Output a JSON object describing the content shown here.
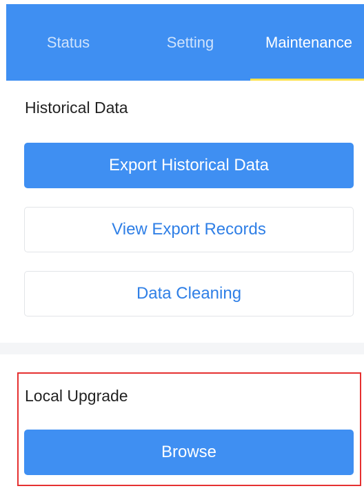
{
  "tabs": [
    {
      "label": "Status",
      "active": false
    },
    {
      "label": "Setting",
      "active": false
    },
    {
      "label": "Maintenance",
      "active": true
    }
  ],
  "historical": {
    "title": "Historical Data",
    "export_label": "Export Historical Data",
    "records_label": "View Export Records",
    "cleaning_label": "Data Cleaning"
  },
  "upgrade": {
    "title": "Local Upgrade",
    "browse_label": "Browse"
  },
  "colors": {
    "primary": "#3f8ff2",
    "active_tab_indicator": "#ffe24a",
    "highlight": "#e53030"
  }
}
